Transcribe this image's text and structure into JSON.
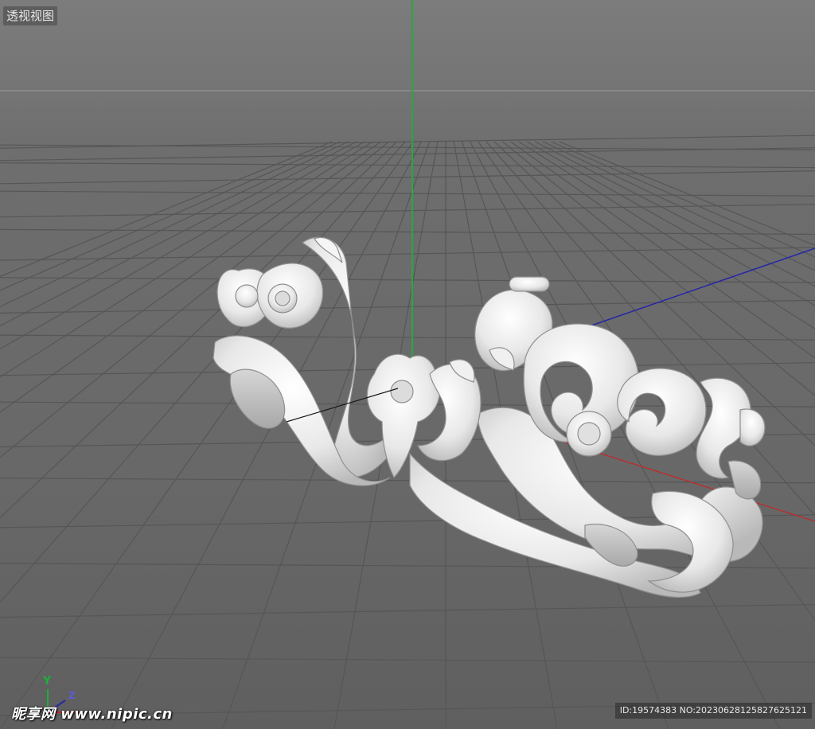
{
  "viewport": {
    "view_name": "透视视图",
    "axis_y_label": "Y",
    "axis_z_label": "Z"
  },
  "colors": {
    "y_axis": "#1fae3a",
    "x_axis": "#c02a2a",
    "z_axis": "#2626a8",
    "grid": "#565656",
    "model": "#f2f2f2"
  },
  "icons": [
    "axis-gizmo-icon",
    "carved-ornament-model"
  ],
  "watermark": {
    "logo_text": "昵享网 www.nipic.cn",
    "id_text": "ID:19574383 NO:20230628125827625121"
  }
}
